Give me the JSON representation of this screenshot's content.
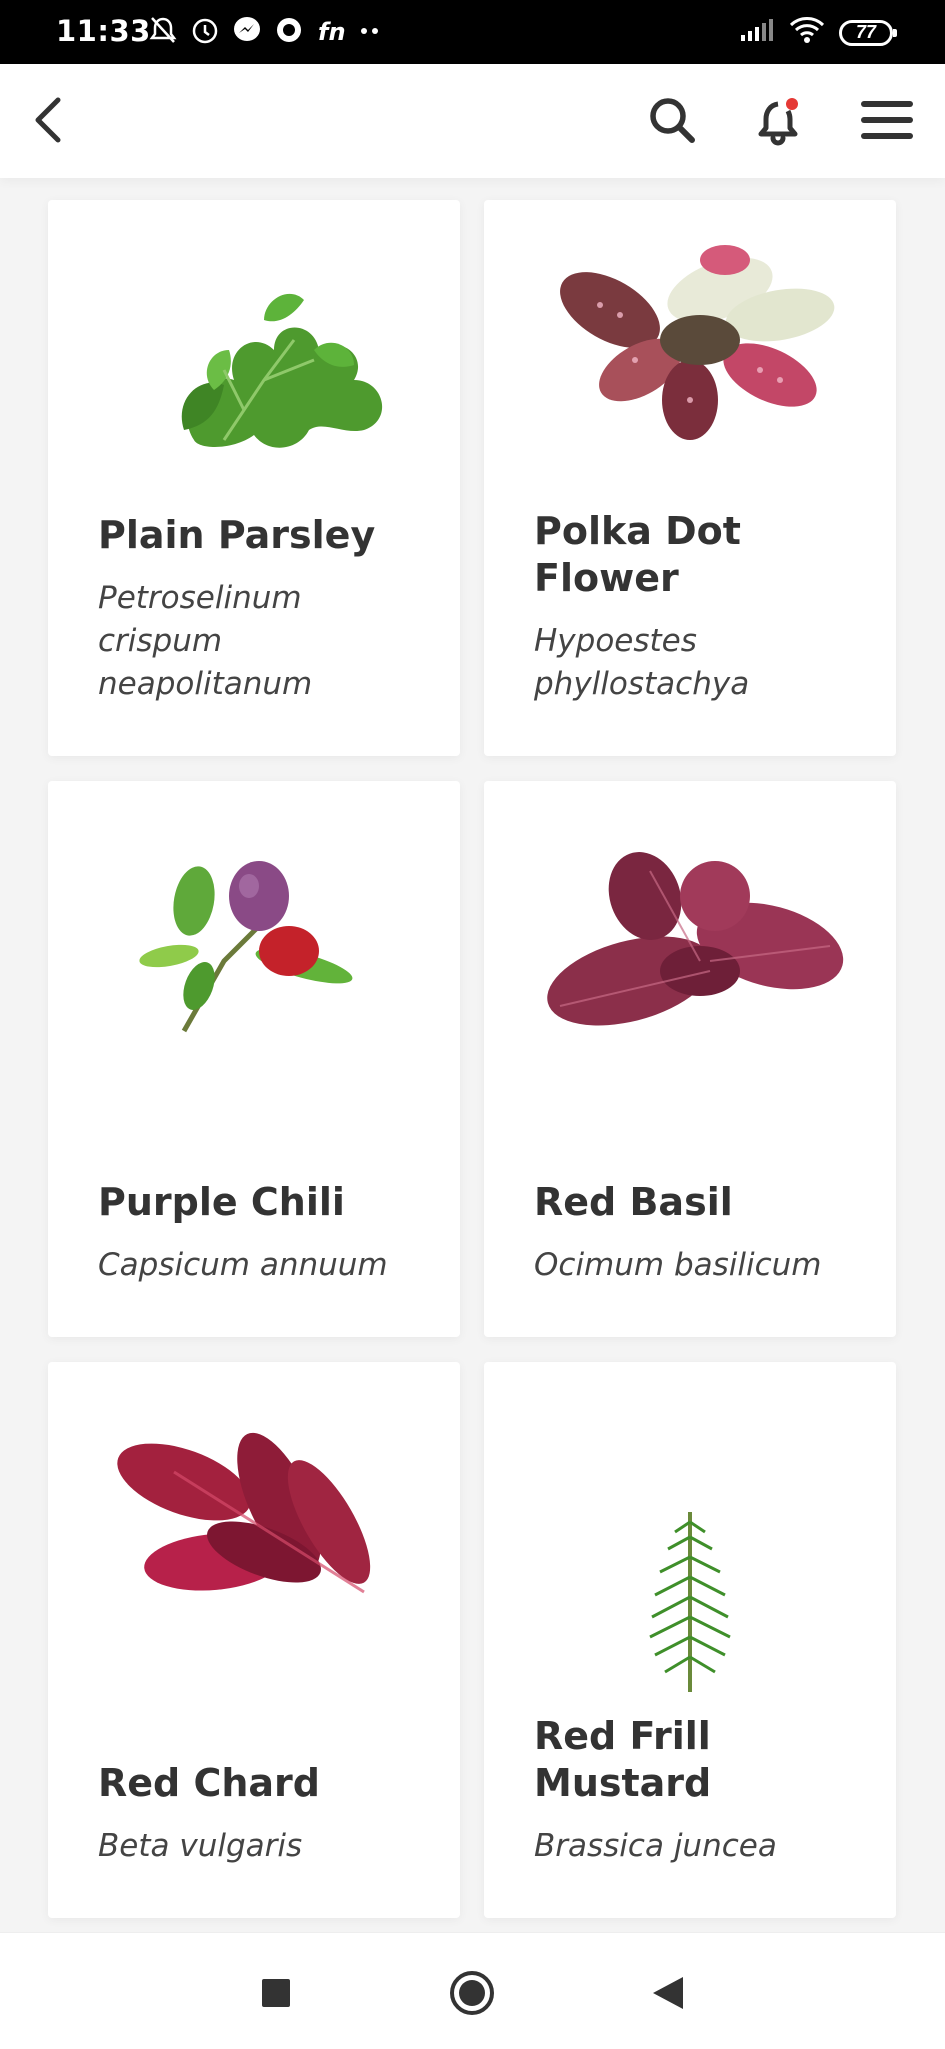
{
  "status_bar": {
    "time": "11:33",
    "battery": "77"
  },
  "app_bar": {
    "back_icon": "chevron-left-icon",
    "search_icon": "search-icon",
    "notification_icon": "bell-icon",
    "notification_dot_color": "#e53935",
    "menu_icon": "hamburger-menu-icon"
  },
  "plants": [
    {
      "name": "Plain Parsley",
      "latin": "Petroselinum crispum neapolitanum",
      "icon": "parsley-image"
    },
    {
      "name": "Polka Dot Flower",
      "latin": "Hypoestes phyllostachya",
      "icon": "polka-dot-flower-image"
    },
    {
      "name": "Purple Chili",
      "latin": "Capsicum annuum",
      "icon": "purple-chili-image"
    },
    {
      "name": "Red Basil",
      "latin": "Ocimum basilicum",
      "icon": "red-basil-image"
    },
    {
      "name": "Red Chard",
      "latin": "Beta vulgaris",
      "icon": "red-chard-image"
    },
    {
      "name": "Red Frill Mustard",
      "latin": "Brassica juncea",
      "icon": "red-frill-mustard-image"
    }
  ],
  "nav_bar": {
    "recents_icon": "square-icon",
    "home_icon": "circle-icon",
    "back_icon": "triangle-back-icon"
  }
}
